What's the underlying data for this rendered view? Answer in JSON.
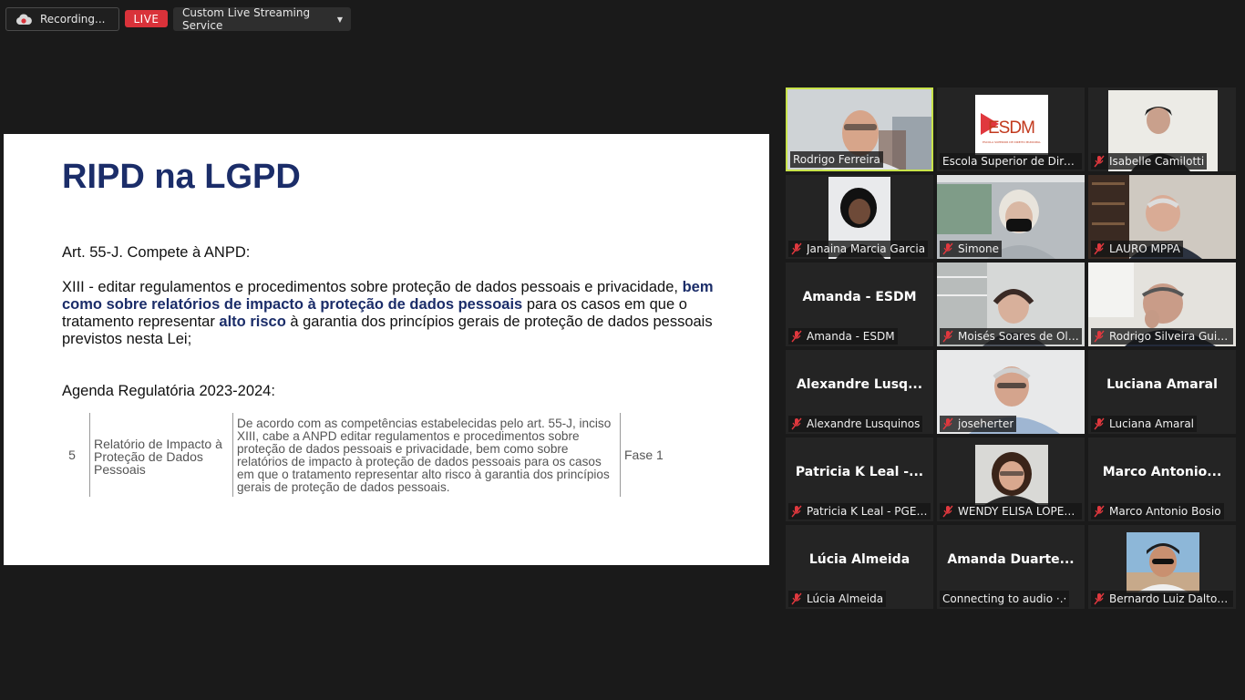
{
  "topbar": {
    "recording_label": "Recording...",
    "live_label": "LIVE",
    "stream_service": "Custom Live Streaming Service"
  },
  "slide": {
    "title": "RIPD na LGPD",
    "art_heading": "Art. 55-J. Compete à ANPD:",
    "para_part1": "XIII - editar regulamentos e procedimentos sobre proteção de dados pessoais e privacidade, ",
    "para_bold1": "bem como sobre relatórios de impacto à proteção de dados pessoais",
    "para_part2": " para os casos em que o tratamento representar ",
    "para_bold2": "alto risco",
    "para_part3": " à garantia dos princípios gerais de proteção de dados pessoais previstos nesta Lei;",
    "agenda_heading": "Agenda Regulatória 2023-2024:",
    "table": {
      "number": "5",
      "topic": "Relatório de Impacto à Proteção de Dados Pessoais",
      "description": "De acordo com as competências estabelecidas pelo art. 55-J, inciso XIII, cabe a ANPD editar regulamentos e procedimentos sobre proteção de dados pessoais e privacidade, bem como sobre relatórios de impacto à proteção de dados pessoais para os casos em que o tratamento representar alto risco à garantia dos princípios gerais de proteção de dados pessoais.",
      "phase": "Fase 1"
    }
  },
  "participants": [
    {
      "name": "Rodrigo Ferreira",
      "muted": false,
      "active": true,
      "video": "person"
    },
    {
      "name": "Escola Superior de Direi...",
      "muted": false,
      "video": "logo",
      "logo_text": "ESDM",
      "logo_sub": "ESCOLA SUPERIOR DE DIREITO MUNICIPAL"
    },
    {
      "name": "Isabelle Camilotti",
      "muted": true,
      "video": "person"
    },
    {
      "name": "Janaina Marcia Garcia",
      "muted": true,
      "video": "person"
    },
    {
      "name": "Simone",
      "muted": true,
      "video": "person"
    },
    {
      "name": "LAURO  MPPA",
      "muted": true,
      "video": "person"
    },
    {
      "name": "Amanda - ESDM",
      "muted": true,
      "video": "none",
      "center": "Amanda - ESDM"
    },
    {
      "name": "Moisés Soares de Oli...",
      "muted": true,
      "video": "person"
    },
    {
      "name": "Rodrigo Silveira Guilh...",
      "muted": true,
      "video": "person"
    },
    {
      "name": "Alexandre Lusquinos",
      "muted": true,
      "video": "none",
      "center": "Alexandre  Lusq..."
    },
    {
      "name": "joseherter",
      "muted": true,
      "video": "person"
    },
    {
      "name": "Luciana Amaral",
      "muted": true,
      "video": "none",
      "center": "Luciana Amaral"
    },
    {
      "name": "Patricia K Leal - PGE/...",
      "muted": true,
      "video": "none",
      "center": "Patricia K Leal -..."
    },
    {
      "name": "WENDY ELISA LOPEZ ...",
      "muted": true,
      "video": "person"
    },
    {
      "name": "Marco Antonio Bosio",
      "muted": true,
      "video": "none",
      "center": "Marco  Antonio..."
    },
    {
      "name": "Lúcia Almeida",
      "muted": true,
      "video": "none",
      "center": "Lúcia Almeida"
    },
    {
      "name": "Connecting to audio ·.·",
      "muted": false,
      "video": "none",
      "center": "Amanda  Duarte..."
    },
    {
      "name": "Bernardo Luiz Daltoé ...",
      "muted": true,
      "video": "person"
    }
  ],
  "colors": {
    "background": "#1a1a1a",
    "live_red": "#d9323a",
    "active_speaker": "#c8e34a",
    "slide_title": "#1b2d69",
    "muted_icon": "#e0383e"
  }
}
